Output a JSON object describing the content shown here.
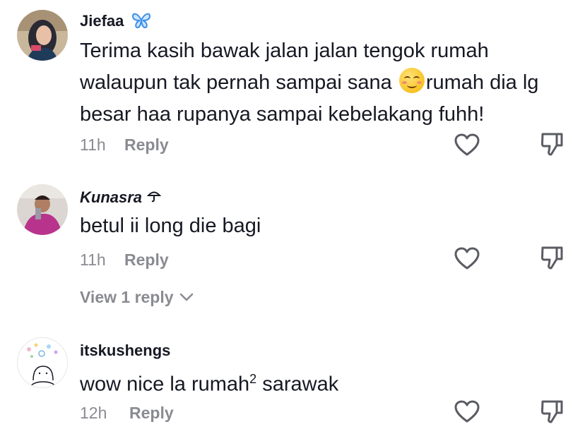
{
  "comments": [
    {
      "username": "Jiefaa",
      "badge": "butterfly-emoji",
      "text_before_emoji": "Terima kasih bawak jalan jalan tengok rumah walaupun tak pernah sampai sana ",
      "emoji": "smiling-face-emoji",
      "text_after_emoji": "rumah dia lg besar haa rupanya sampai kebelakang fuhh!",
      "time": "11h",
      "reply_label": "Reply"
    },
    {
      "username": "Kunasra",
      "badge": "umbrella-symbol",
      "text": "betul ii long die bagi",
      "time": "11h",
      "reply_label": "Reply",
      "view_replies": "View 1 reply"
    },
    {
      "username": "itskushengs",
      "text_main": "wow nice la rumah",
      "text_sup": "2",
      "text_tail": " sarawak",
      "time": "12h",
      "reply_label": "Reply"
    }
  ],
  "colors": {
    "text": "#161823",
    "muted": "#8a8b91",
    "badge_blue": "#3b8fe8"
  }
}
